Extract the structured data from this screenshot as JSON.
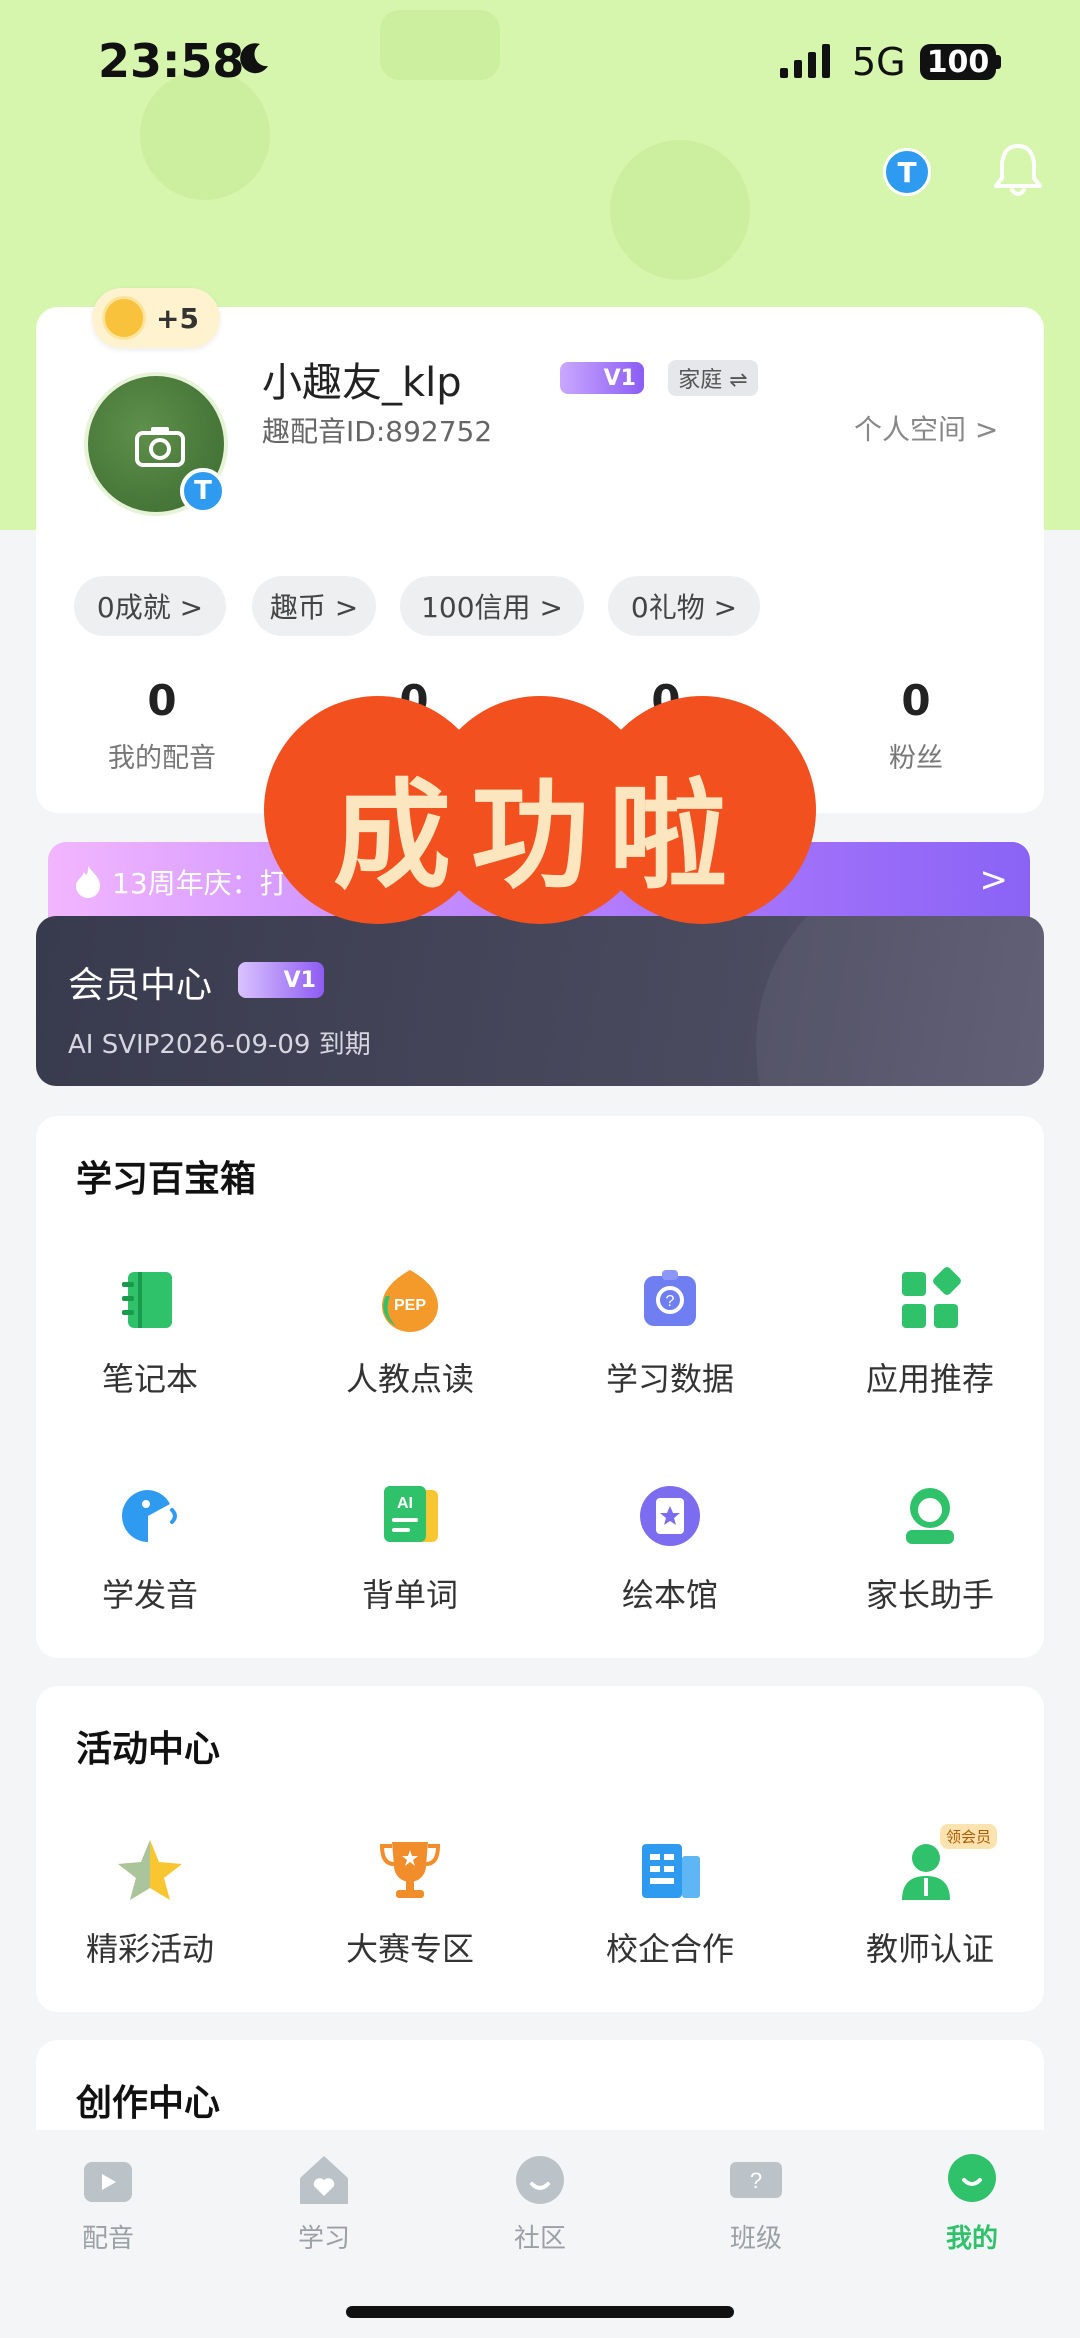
{
  "status_bar": {
    "time": "23:58",
    "network": "5G",
    "battery": "100"
  },
  "profile": {
    "coin_bonus": "+5",
    "username": "小趣友_klp",
    "vip_level": "V1",
    "family_tag": "家庭 ⇌",
    "user_id": "趣配音ID:892752",
    "personal_space": "个人空间 >",
    "chips": [
      "0成就 >",
      "趣币 >",
      "100信用 >",
      "0礼物 >"
    ],
    "stats": [
      {
        "value": "0",
        "label": "我的配音"
      },
      {
        "value": "0",
        "label": ""
      },
      {
        "value": "0",
        "label": ""
      },
      {
        "value": "0",
        "label": "粉丝"
      }
    ]
  },
  "anniversary": {
    "text": "13周年庆：打",
    "chevron": ">"
  },
  "vip_center": {
    "title": "会员中心",
    "level": "V1",
    "expire": "AI SVIP2026-09-09 到期"
  },
  "stamp_text": "成功啦",
  "study_box": {
    "title": "学习百宝箱",
    "items": [
      {
        "label": "笔记本",
        "icon": "notebook-icon",
        "color": "#2fc26a"
      },
      {
        "label": "人教点读",
        "icon": "pep-icon",
        "color": "#f39a2b"
      },
      {
        "label": "学习数据",
        "icon": "study-data-icon",
        "color": "#6f7ff2"
      },
      {
        "label": "应用推荐",
        "icon": "apps-icon",
        "color": "#2fc26a"
      },
      {
        "label": "学发音",
        "icon": "pronunciation-icon",
        "color": "#2f9bf0"
      },
      {
        "label": "背单词",
        "icon": "vocabulary-icon",
        "color": "#2fc26a"
      },
      {
        "label": "绘本馆",
        "icon": "picture-book-icon",
        "color": "#7b6cf0"
      },
      {
        "label": "家长助手",
        "icon": "parent-assistant-icon",
        "color": "#2fc26a"
      }
    ]
  },
  "activity_center": {
    "title": "活动中心",
    "items": [
      {
        "label": "精彩活动",
        "icon": "star-icon",
        "color": "#f7c630"
      },
      {
        "label": "大赛专区",
        "icon": "trophy-icon",
        "color": "#f28d2b"
      },
      {
        "label": "校企合作",
        "icon": "cooperation-icon",
        "color": "#2f9bf0"
      },
      {
        "label": "教师认证",
        "icon": "teacher-icon",
        "color": "#2fc26a",
        "badge": "领会员"
      }
    ]
  },
  "creation_center": {
    "title": "创作中心"
  },
  "bottom_nav": [
    {
      "label": "配音",
      "active": false
    },
    {
      "label": "学习",
      "active": false
    },
    {
      "label": "社区",
      "active": false
    },
    {
      "label": "班级",
      "active": false
    },
    {
      "label": "我的",
      "active": true
    }
  ],
  "colors": {
    "accent": "#2fc26a",
    "hero": "#d6f5ad",
    "stamp": "#f2501e"
  }
}
